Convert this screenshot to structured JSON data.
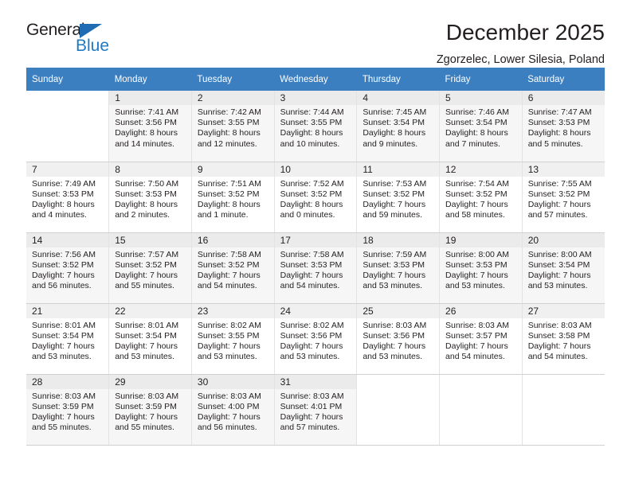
{
  "brand": {
    "name_dark": "General",
    "name_blue": "Blue",
    "triangle_color": "#1f6cb4",
    "blue_color": "#1f7ac4"
  },
  "header": {
    "title": "December 2025",
    "subtitle": "Zgorzelec, Lower Silesia, Poland"
  },
  "theme": {
    "header_bg": "#3c7fc1",
    "header_text": "#ffffff",
    "daynum_bg": "#f0f0f0",
    "row_shaded_bg": "#f6f6f6",
    "text": "#231f20"
  },
  "weekdays": [
    "Sunday",
    "Monday",
    "Tuesday",
    "Wednesday",
    "Thursday",
    "Friday",
    "Saturday"
  ],
  "labels": {
    "sunrise_prefix": "Sunrise:",
    "sunset_prefix": "Sunset:",
    "daylight_prefix": "Daylight:"
  },
  "weeks": [
    [
      {
        "day": "",
        "sunrise": "",
        "sunset": "",
        "daylight_1": "",
        "daylight_2": "",
        "empty": true
      },
      {
        "day": "1",
        "sunrise": "Sunrise: 7:41 AM",
        "sunset": "Sunset: 3:56 PM",
        "daylight_1": "Daylight: 8 hours",
        "daylight_2": "and 14 minutes."
      },
      {
        "day": "2",
        "sunrise": "Sunrise: 7:42 AM",
        "sunset": "Sunset: 3:55 PM",
        "daylight_1": "Daylight: 8 hours",
        "daylight_2": "and 12 minutes."
      },
      {
        "day": "3",
        "sunrise": "Sunrise: 7:44 AM",
        "sunset": "Sunset: 3:55 PM",
        "daylight_1": "Daylight: 8 hours",
        "daylight_2": "and 10 minutes."
      },
      {
        "day": "4",
        "sunrise": "Sunrise: 7:45 AM",
        "sunset": "Sunset: 3:54 PM",
        "daylight_1": "Daylight: 8 hours",
        "daylight_2": "and 9 minutes."
      },
      {
        "day": "5",
        "sunrise": "Sunrise: 7:46 AM",
        "sunset": "Sunset: 3:54 PM",
        "daylight_1": "Daylight: 8 hours",
        "daylight_2": "and 7 minutes."
      },
      {
        "day": "6",
        "sunrise": "Sunrise: 7:47 AM",
        "sunset": "Sunset: 3:53 PM",
        "daylight_1": "Daylight: 8 hours",
        "daylight_2": "and 5 minutes."
      }
    ],
    [
      {
        "day": "7",
        "sunrise": "Sunrise: 7:49 AM",
        "sunset": "Sunset: 3:53 PM",
        "daylight_1": "Daylight: 8 hours",
        "daylight_2": "and 4 minutes."
      },
      {
        "day": "8",
        "sunrise": "Sunrise: 7:50 AM",
        "sunset": "Sunset: 3:53 PM",
        "daylight_1": "Daylight: 8 hours",
        "daylight_2": "and 2 minutes."
      },
      {
        "day": "9",
        "sunrise": "Sunrise: 7:51 AM",
        "sunset": "Sunset: 3:52 PM",
        "daylight_1": "Daylight: 8 hours",
        "daylight_2": "and 1 minute."
      },
      {
        "day": "10",
        "sunrise": "Sunrise: 7:52 AM",
        "sunset": "Sunset: 3:52 PM",
        "daylight_1": "Daylight: 8 hours",
        "daylight_2": "and 0 minutes."
      },
      {
        "day": "11",
        "sunrise": "Sunrise: 7:53 AM",
        "sunset": "Sunset: 3:52 PM",
        "daylight_1": "Daylight: 7 hours",
        "daylight_2": "and 59 minutes."
      },
      {
        "day": "12",
        "sunrise": "Sunrise: 7:54 AM",
        "sunset": "Sunset: 3:52 PM",
        "daylight_1": "Daylight: 7 hours",
        "daylight_2": "and 58 minutes."
      },
      {
        "day": "13",
        "sunrise": "Sunrise: 7:55 AM",
        "sunset": "Sunset: 3:52 PM",
        "daylight_1": "Daylight: 7 hours",
        "daylight_2": "and 57 minutes."
      }
    ],
    [
      {
        "day": "14",
        "sunrise": "Sunrise: 7:56 AM",
        "sunset": "Sunset: 3:52 PM",
        "daylight_1": "Daylight: 7 hours",
        "daylight_2": "and 56 minutes."
      },
      {
        "day": "15",
        "sunrise": "Sunrise: 7:57 AM",
        "sunset": "Sunset: 3:52 PM",
        "daylight_1": "Daylight: 7 hours",
        "daylight_2": "and 55 minutes."
      },
      {
        "day": "16",
        "sunrise": "Sunrise: 7:58 AM",
        "sunset": "Sunset: 3:52 PM",
        "daylight_1": "Daylight: 7 hours",
        "daylight_2": "and 54 minutes."
      },
      {
        "day": "17",
        "sunrise": "Sunrise: 7:58 AM",
        "sunset": "Sunset: 3:53 PM",
        "daylight_1": "Daylight: 7 hours",
        "daylight_2": "and 54 minutes."
      },
      {
        "day": "18",
        "sunrise": "Sunrise: 7:59 AM",
        "sunset": "Sunset: 3:53 PM",
        "daylight_1": "Daylight: 7 hours",
        "daylight_2": "and 53 minutes."
      },
      {
        "day": "19",
        "sunrise": "Sunrise: 8:00 AM",
        "sunset": "Sunset: 3:53 PM",
        "daylight_1": "Daylight: 7 hours",
        "daylight_2": "and 53 minutes."
      },
      {
        "day": "20",
        "sunrise": "Sunrise: 8:00 AM",
        "sunset": "Sunset: 3:54 PM",
        "daylight_1": "Daylight: 7 hours",
        "daylight_2": "and 53 minutes."
      }
    ],
    [
      {
        "day": "21",
        "sunrise": "Sunrise: 8:01 AM",
        "sunset": "Sunset: 3:54 PM",
        "daylight_1": "Daylight: 7 hours",
        "daylight_2": "and 53 minutes."
      },
      {
        "day": "22",
        "sunrise": "Sunrise: 8:01 AM",
        "sunset": "Sunset: 3:54 PM",
        "daylight_1": "Daylight: 7 hours",
        "daylight_2": "and 53 minutes."
      },
      {
        "day": "23",
        "sunrise": "Sunrise: 8:02 AM",
        "sunset": "Sunset: 3:55 PM",
        "daylight_1": "Daylight: 7 hours",
        "daylight_2": "and 53 minutes."
      },
      {
        "day": "24",
        "sunrise": "Sunrise: 8:02 AM",
        "sunset": "Sunset: 3:56 PM",
        "daylight_1": "Daylight: 7 hours",
        "daylight_2": "and 53 minutes."
      },
      {
        "day": "25",
        "sunrise": "Sunrise: 8:03 AM",
        "sunset": "Sunset: 3:56 PM",
        "daylight_1": "Daylight: 7 hours",
        "daylight_2": "and 53 minutes."
      },
      {
        "day": "26",
        "sunrise": "Sunrise: 8:03 AM",
        "sunset": "Sunset: 3:57 PM",
        "daylight_1": "Daylight: 7 hours",
        "daylight_2": "and 54 minutes."
      },
      {
        "day": "27",
        "sunrise": "Sunrise: 8:03 AM",
        "sunset": "Sunset: 3:58 PM",
        "daylight_1": "Daylight: 7 hours",
        "daylight_2": "and 54 minutes."
      }
    ],
    [
      {
        "day": "28",
        "sunrise": "Sunrise: 8:03 AM",
        "sunset": "Sunset: 3:59 PM",
        "daylight_1": "Daylight: 7 hours",
        "daylight_2": "and 55 minutes."
      },
      {
        "day": "29",
        "sunrise": "Sunrise: 8:03 AM",
        "sunset": "Sunset: 3:59 PM",
        "daylight_1": "Daylight: 7 hours",
        "daylight_2": "and 55 minutes."
      },
      {
        "day": "30",
        "sunrise": "Sunrise: 8:03 AM",
        "sunset": "Sunset: 4:00 PM",
        "daylight_1": "Daylight: 7 hours",
        "daylight_2": "and 56 minutes."
      },
      {
        "day": "31",
        "sunrise": "Sunrise: 8:03 AM",
        "sunset": "Sunset: 4:01 PM",
        "daylight_1": "Daylight: 7 hours",
        "daylight_2": "and 57 minutes."
      },
      {
        "day": "",
        "sunrise": "",
        "sunset": "",
        "daylight_1": "",
        "daylight_2": "",
        "empty": true
      },
      {
        "day": "",
        "sunrise": "",
        "sunset": "",
        "daylight_1": "",
        "daylight_2": "",
        "empty": true
      },
      {
        "day": "",
        "sunrise": "",
        "sunset": "",
        "daylight_1": "",
        "daylight_2": "",
        "empty": true
      }
    ]
  ]
}
